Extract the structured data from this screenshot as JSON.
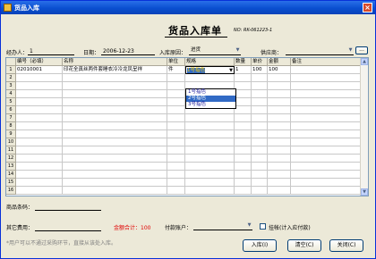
{
  "window": {
    "title": "货品入库"
  },
  "header": {
    "heading": "货品入库单",
    "doc_no": "NO: RK-061223-1"
  },
  "form": {
    "handler_label": "经办人：",
    "handler_value": "1",
    "date_label": "日期：",
    "date_value": "2006-12-23",
    "reason_label": "入库原因：",
    "reason_value": "进货",
    "supplier_label": "供应商：",
    "supplier_value": "",
    "browse_label": "..."
  },
  "grid": {
    "columns": [
      "编号（必填）",
      "名称",
      "单位",
      "规格",
      "数量",
      "单价",
      "金额",
      "备注"
    ],
    "row_numbers": [
      "1",
      "2",
      "3",
      "4",
      "5",
      "6",
      "7",
      "8",
      "9",
      "10",
      "11",
      "12",
      "13",
      "14",
      "15",
      "16"
    ],
    "rows": [
      [
        "02010001",
        "印花全真丝两件套睡衣冷冷龙凤呈祥",
        "件",
        "1号指色",
        "1",
        "100",
        "100",
        ""
      ]
    ],
    "dropdown_options": [
      "1号指色",
      "2号指色",
      "3号指色"
    ],
    "dropdown_selected_index": 1,
    "scroll_up": "▲",
    "scroll_down": "▼"
  },
  "footer": {
    "barcode_label": "商品条码：",
    "other_fee_label": "其它费用：",
    "total_label": "金额合计：100",
    "account_label": "付款账户：",
    "account_value": "",
    "credit_label": "挂帐(计入应付款)",
    "hint": "*用户可以不通过采购环节，直接从该处入库。"
  },
  "buttons": {
    "in_label": "入库(I)",
    "clear_label": "清空(C)",
    "close_label": "关闭(C)"
  },
  "colors": {
    "title_blue": "#0a4fd0",
    "total_red": "#e00000",
    "selection_blue": "#316ac5"
  }
}
